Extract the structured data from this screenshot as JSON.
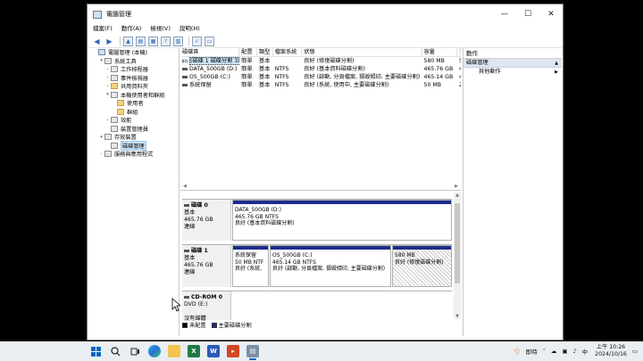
{
  "window": {
    "title": "電腦管理",
    "controls": {
      "minimize": "—",
      "maximize": "☐",
      "close": "✕"
    }
  },
  "menu": [
    "檔案(F)",
    "動作(A)",
    "檢視(V)",
    "說明(H)"
  ],
  "tree": [
    {
      "label": "電腦管理 (本機)",
      "indent": 0,
      "arrow": "",
      "icon": "pc"
    },
    {
      "label": "系統工具",
      "indent": 1,
      "arrow": "▾",
      "icon": "tool"
    },
    {
      "label": "工作排程器",
      "indent": 2,
      "arrow": "›",
      "icon": "clock"
    },
    {
      "label": "事件檢視器",
      "indent": 2,
      "arrow": "›",
      "icon": "event"
    },
    {
      "label": "共用資料夾",
      "indent": 2,
      "arrow": "›",
      "icon": "folder"
    },
    {
      "label": "本機使用者和群組",
      "indent": 2,
      "arrow": "▾",
      "icon": "users"
    },
    {
      "label": "使用者",
      "indent": 3,
      "arrow": "",
      "icon": "folder"
    },
    {
      "label": "群組",
      "indent": 3,
      "arrow": "",
      "icon": "folder"
    },
    {
      "label": "效能",
      "indent": 2,
      "arrow": "›",
      "icon": "perf"
    },
    {
      "label": "裝置管理員",
      "indent": 2,
      "arrow": "",
      "icon": "device"
    },
    {
      "label": "存放裝置",
      "indent": 1,
      "arrow": "▾",
      "icon": "storage"
    },
    {
      "label": "磁碟管理",
      "indent": 2,
      "arrow": "",
      "icon": "disk",
      "selected": true
    },
    {
      "label": "服務與應用程式",
      "indent": 1,
      "arrow": "›",
      "icon": "services"
    }
  ],
  "volume_list": {
    "headers": [
      "磁碟區",
      "配置",
      "類型",
      "檔案系統",
      "狀態",
      "容量",
      "可"
    ],
    "rows": [
      [
        "(磁碟 1 磁碟分割 3)",
        "簡單",
        "基本",
        "",
        "良好 (修復磁碟分割)",
        "580 MB",
        "5"
      ],
      [
        "DATA_500GB (D:)",
        "簡單",
        "基本",
        "NTFS",
        "良好 (基本資料磁碟分割)",
        "465.76 GB",
        "4"
      ],
      [
        "OS_500GB (C:)",
        "簡單",
        "基本",
        "NTFS",
        "良好 (啟動, 分頁檔案, 損毀傾印, 主要磁碟分割)",
        "465.14 GB",
        "4"
      ],
      [
        "系統保留",
        "簡單",
        "基本",
        "NTFS",
        "良好 (系統, 使用中, 主要磁碟分割)",
        "50 MB",
        "2"
      ]
    ]
  },
  "disks": [
    {
      "name": "磁碟 0",
      "type": "基本",
      "size": "465.76 GB",
      "status": "連線",
      "partitions": [
        {
          "name": "DATA_500GB  (D:)",
          "size": "465.76 GB NTFS",
          "status": "良好 (基本資料磁碟分割)"
        }
      ]
    },
    {
      "name": "磁碟 1",
      "type": "基本",
      "size": "465.76 GB",
      "status": "連線",
      "partitions": [
        {
          "name": "系統保留",
          "size": "50 MB NTF",
          "status": "良好 (系統,"
        },
        {
          "name": "OS_500GB  (C:)",
          "size": "465.14 GB NTFS",
          "status": "良好 (啟動, 分頁檔案, 損毀傾印, 主要磁碟分割)"
        },
        {
          "name": "",
          "size": "580 MB",
          "status": "良好 (修復磁碟分割)"
        }
      ]
    },
    {
      "name": "CD-ROM 0",
      "type": "DVD (E:)",
      "size": "",
      "status": "",
      "media": "沒有媒體"
    }
  ],
  "legend": [
    {
      "label": "未配置",
      "color": "#000000"
    },
    {
      "label": "主要磁碟分割",
      "color": "#1c2c8c"
    }
  ],
  "actions": {
    "header": "動作",
    "section": "磁碟管理",
    "item": "其他動作"
  },
  "taskbar": {
    "tray_label": "即時",
    "ime": "中",
    "time": "上午 10:26",
    "date": "2024/10/16"
  }
}
